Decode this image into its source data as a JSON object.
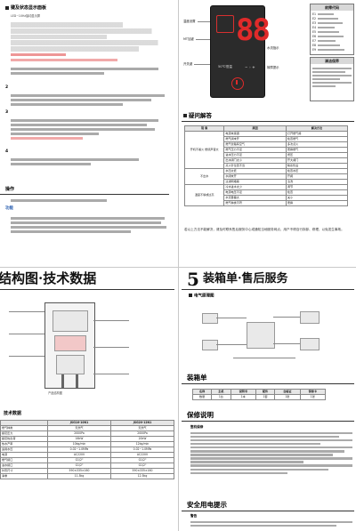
{
  "tl": {
    "title": "键及状态显示面板",
    "subtitle": "LED~10Hz抽动显示屏",
    "heading2": "2",
    "heading3": "3",
    "heading4": "4",
    "blue_note": "功能",
    "section_label": "操作",
    "lines": [
      "控制面板及按键说明",
      "开机、关机、设定温度",
      "出水温度设定方法",
      "定温功能",
      "童锁功能",
      "故障显示与处理"
    ]
  },
  "tr": {
    "panel": {
      "temp_label": "50℃恒温",
      "digits": "88"
    },
    "labels": {
      "left1": "温度设置",
      "left2": "MT加键",
      "left3": "开关键",
      "right1": "水流指示",
      "right2": "故障提示"
    },
    "code_box": {
      "title": "故障代码",
      "codes": [
        "E1",
        "E2",
        "E3",
        "E4",
        "E5",
        "E6",
        "E7",
        "E8",
        "E9"
      ]
    },
    "care_box": {
      "title": "清洁保养"
    },
    "faq": {
      "title": "疑问解答",
      "headers": [
        "现 象",
        "原因",
        "解决方法"
      ],
      "groups": [
        "开机不着火 燃烧声音大",
        "不出水",
        "温度不够或过高"
      ],
      "rows": [
        [
          "电源未接通",
          "打开燃气阀"
        ],
        [
          "燃气阀未开",
          "检查燃气"
        ],
        [
          "燃气管路有空气",
          "多次点火"
        ],
        [
          "燃气压力不足",
          "更换燃气"
        ],
        [
          "进水压力不足",
          "增压"
        ],
        [
          "出水阀门太小",
          "开大阀门"
        ],
        [
          "点火针位置不当",
          "联系售后"
        ],
        [
          "水压太低",
          "检查水压"
        ],
        [
          "水阀未开",
          "开阀"
        ],
        [
          "过滤网堵塞",
          "清洗"
        ],
        [
          "冷水进水太少",
          "调节"
        ],
        [
          "电源电压不足",
          "检查"
        ],
        [
          "水流量偏大",
          "关小"
        ],
        [
          "燃气种类不符",
          "更换"
        ]
      ],
      "footnote": "若以上方法不能解决，请及时联系售后服务中心或通知当地服务网点，用户不得自行拆卸、修理，以免发生事故。"
    }
  },
  "bl": {
    "title": "结构图·技术数据",
    "sub1": "结构示意",
    "caption": "产品结构图",
    "table": {
      "title": "技术数据",
      "models": [
        "JSG16-10N1",
        "JSG20-12N1"
      ],
      "rows": [
        [
          "燃气种类",
          "天然气",
          "天然气"
        ],
        [
          "额定压力",
          "2000Pa",
          "2000Pa"
        ],
        [
          "额定热负荷",
          "16kW",
          "20kW"
        ],
        [
          "热水产率",
          "10kg/min",
          "12kg/min"
        ],
        [
          "适用水压",
          "0.02~1.0MPa",
          "0.02~1.0MPa"
        ],
        [
          "电源",
          "AC220V",
          "AC220V"
        ],
        [
          "燃气接口",
          "G1/2\"",
          "G1/2\""
        ],
        [
          "进水接口",
          "G1/2\"",
          "G1/2\""
        ],
        [
          "外形尺寸",
          "590×335×160",
          "590×335×160"
        ],
        [
          "净重",
          "11.5kg",
          "12.5kg"
        ]
      ]
    }
  },
  "br": {
    "num": "5",
    "title": "装箱单·售后服务",
    "elec": "电气原理图",
    "packing": {
      "title": "装箱单",
      "headers": [
        "名称",
        "主机",
        "说明书",
        "配件",
        "合格证",
        "保修卡"
      ],
      "row": [
        "数量",
        "1台",
        "1本",
        "1套",
        "1张",
        "1张"
      ]
    },
    "warranty": {
      "title": "保修说明",
      "sub": "整机保修"
    },
    "safety": {
      "title": "安全用电提示",
      "sub": "警告"
    }
  }
}
